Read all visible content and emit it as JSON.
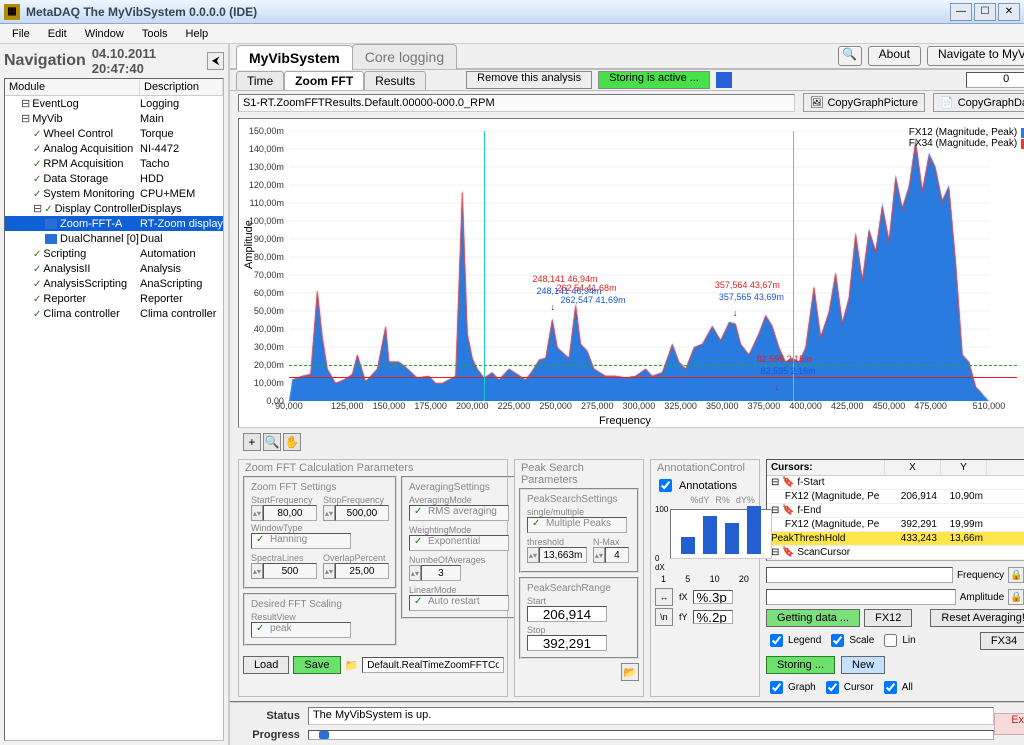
{
  "window": {
    "title": "MetaDAQ The MyVibSystem  0.0.0.0  (IDE)",
    "menus": [
      "File",
      "Edit",
      "Window",
      "Tools",
      "Help"
    ]
  },
  "nav": {
    "title": "Navigation",
    "datetime": "04.10.2011  20:47:40"
  },
  "tree": {
    "headers": [
      "Module",
      "Description"
    ],
    "rows": [
      {
        "ind": 1,
        "exp": "minus",
        "chk": false,
        "label": "EventLog",
        "desc": "Logging"
      },
      {
        "ind": 1,
        "exp": "minus",
        "chk": false,
        "label": "MyVib",
        "desc": "Main"
      },
      {
        "ind": 2,
        "chk": true,
        "label": "Wheel Control",
        "desc": "Torque"
      },
      {
        "ind": 2,
        "chk": true,
        "label": "Analog Acquisition",
        "desc": "NI-4472"
      },
      {
        "ind": 2,
        "chk": true,
        "label": "RPM Acquisition",
        "desc": "Tacho"
      },
      {
        "ind": 2,
        "chk": true,
        "label": "Data Storage",
        "desc": "HDD"
      },
      {
        "ind": 2,
        "chk": true,
        "label": "System Monitoring",
        "desc": "CPU+MEM"
      },
      {
        "ind": 2,
        "exp": "minus",
        "chk": true,
        "label": "Display Controller",
        "desc": "Displays"
      },
      {
        "ind": 3,
        "sel": true,
        "icon": "blue",
        "label": "Zoom-FFT-A",
        "desc": "RT-Zoom display"
      },
      {
        "ind": 3,
        "icon": "blue",
        "label": "DualChannel [0]",
        "desc": "Dual"
      },
      {
        "ind": 2,
        "chk": true,
        "label": "Scripting",
        "desc": "Automation"
      },
      {
        "ind": 2,
        "chk": true,
        "label": "AnalysisII",
        "desc": "Analysis"
      },
      {
        "ind": 2,
        "chk": true,
        "label": "AnalysisScripting",
        "desc": "AnaScripting"
      },
      {
        "ind": 2,
        "chk": true,
        "label": "Reporter",
        "desc": "Reporter"
      },
      {
        "ind": 2,
        "chk": true,
        "label": "Clima controller",
        "desc": "Clima controller"
      }
    ]
  },
  "main_tabs": {
    "items": [
      "MyVibSystem",
      "Core logging"
    ],
    "active": 0
  },
  "main_buttons": {
    "about": "About",
    "navigate": "Navigate to MyVib"
  },
  "sub_tabs": {
    "items": [
      "Time",
      "Zoom FFT",
      "Results"
    ],
    "active": 1,
    "remove": "Remove this analysis",
    "storing": "Storing is active ...",
    "counter": "0"
  },
  "chart_row": {
    "filename": "S1-RT.ZoomFFTResults.Default.00000-000.0_RPM",
    "copy_pic": "CopyGraphPicture",
    "copy_data": "CopyGraphData"
  },
  "chart_data": {
    "type": "line",
    "title": "",
    "xlabel": "Frequency",
    "ylabel": "Amplitude",
    "xlim": [
      90000,
      510000
    ],
    "ylim": [
      0,
      0.15
    ],
    "xticks": [
      90000,
      125000,
      150000,
      175000,
      200000,
      225000,
      250000,
      275000,
      300000,
      325000,
      350000,
      375000,
      400000,
      425000,
      450000,
      475000,
      510000
    ],
    "yticks_labels": [
      "0,00",
      "10,00m",
      "20,00m",
      "30,00m",
      "40,00m",
      "50,00m",
      "60,00m",
      "70,00m",
      "80,00m",
      "90,00m",
      "100,00m",
      "110,00m",
      "120,00m",
      "130,00m",
      "140,00m",
      "150,00m"
    ],
    "threshold_line_red": 0.0137,
    "threshold_line_green": 0.02,
    "vlines": [
      {
        "x": 392291,
        "color": "orange",
        "name": "f-End"
      },
      {
        "x": 206914,
        "color": "cyan",
        "name": "f-Start"
      }
    ],
    "series": [
      {
        "name": "FX12 (Magnitude, Peak)",
        "color": "#2a7be0"
      },
      {
        "name": "FX34 (Magnitude, Peak)",
        "color": "#e03a3a"
      }
    ],
    "annotations": [
      {
        "color": "red",
        "x": 248141,
        "y": 0.04694,
        "label": "248,141 46,94m"
      },
      {
        "color": "blue",
        "x": 248141,
        "y": 0.04694,
        "label": "248,141 46,94m"
      },
      {
        "color": "red",
        "x": 262547,
        "y": 0.04168,
        "label": "262,54 41,68m"
      },
      {
        "color": "blue",
        "x": 262547,
        "y": 0.04169,
        "label": "262,547 41,69m"
      },
      {
        "color": "red",
        "x": 357564,
        "y": 0.04367,
        "label": "357,564 43,67m"
      },
      {
        "color": "blue",
        "x": 357565,
        "y": 0.04369,
        "label": "357,565 43,69m"
      },
      {
        "color": "red",
        "x": 382595,
        "y": 0.00215,
        "label": "82,595 2,15m"
      },
      {
        "color": "blue",
        "x": 382595,
        "y": 0.00216,
        "label": "82,595 2,16m"
      }
    ],
    "profile": [
      [
        92,
        12
      ],
      [
        98,
        14
      ],
      [
        103,
        15
      ],
      [
        107,
        62
      ],
      [
        110,
        36
      ],
      [
        113,
        18
      ],
      [
        118,
        10
      ],
      [
        123,
        12
      ],
      [
        128,
        15
      ],
      [
        131,
        26
      ],
      [
        136,
        11
      ],
      [
        143,
        18
      ],
      [
        148,
        42
      ],
      [
        150,
        22
      ],
      [
        156,
        22
      ],
      [
        160,
        19
      ],
      [
        167,
        13
      ],
      [
        174,
        14
      ],
      [
        178,
        10
      ],
      [
        182,
        10
      ],
      [
        186,
        12
      ],
      [
        190,
        14
      ],
      [
        194,
        118
      ],
      [
        197,
        38
      ],
      [
        200,
        24
      ],
      [
        203,
        18
      ],
      [
        207,
        13
      ],
      [
        212,
        16
      ],
      [
        216,
        12
      ],
      [
        222,
        18
      ],
      [
        227,
        15
      ],
      [
        232,
        12
      ],
      [
        236,
        17
      ],
      [
        240,
        23
      ],
      [
        244,
        24
      ],
      [
        248,
        46
      ],
      [
        251,
        30
      ],
      [
        258,
        24
      ],
      [
        262,
        54
      ],
      [
        265,
        32
      ],
      [
        269,
        28
      ],
      [
        273,
        18
      ],
      [
        280,
        14
      ],
      [
        286,
        14
      ],
      [
        292,
        13
      ],
      [
        298,
        14
      ],
      [
        304,
        18
      ],
      [
        308,
        14
      ],
      [
        314,
        16
      ],
      [
        320,
        32
      ],
      [
        324,
        22
      ],
      [
        328,
        18
      ],
      [
        333,
        30
      ],
      [
        338,
        32
      ],
      [
        344,
        42
      ],
      [
        349,
        34
      ],
      [
        354,
        44
      ],
      [
        358,
        43
      ],
      [
        361,
        32
      ],
      [
        366,
        26
      ],
      [
        372,
        38
      ],
      [
        376,
        48
      ],
      [
        380,
        42
      ],
      [
        384,
        30
      ],
      [
        388,
        22
      ],
      [
        392,
        24
      ],
      [
        396,
        22
      ],
      [
        400,
        30
      ],
      [
        405,
        64
      ],
      [
        409,
        36
      ],
      [
        414,
        50
      ],
      [
        418,
        72
      ],
      [
        422,
        44
      ],
      [
        426,
        58
      ],
      [
        430,
        94
      ],
      [
        434,
        68
      ],
      [
        438,
        96
      ],
      [
        442,
        84
      ],
      [
        446,
        110
      ],
      [
        450,
        90
      ],
      [
        454,
        126
      ],
      [
        458,
        108
      ],
      [
        462,
        120
      ],
      [
        466,
        146
      ],
      [
        470,
        118
      ],
      [
        474,
        138
      ],
      [
        478,
        130
      ],
      [
        482,
        112
      ],
      [
        486,
        120
      ],
      [
        490,
        78
      ],
      [
        494,
        26
      ],
      [
        498,
        22
      ],
      [
        502,
        8
      ],
      [
        506,
        4
      ]
    ]
  },
  "zoom_fft_params": {
    "title": "Zoom FFT Calculation Parameters",
    "settings_title": "Zoom FFT Settings",
    "start_freq_label": "StartFrequency",
    "start_freq": "80,00",
    "stop_freq_label": "StopFrequency",
    "stop_freq": "500,00",
    "window_type_label": "WindowType",
    "window_type": "Hanning",
    "spectra_label": "SpectraLines",
    "spectra": "500",
    "overlap_label": "OverlapPercent",
    "overlap": "25,00",
    "scaling_title": "Desired FFT Scaling",
    "result_view_label": "ResultView",
    "result_view": "peak",
    "avg_title": "AveragingSettings",
    "avg_mode_label": "AveragingMode",
    "avg_mode": "RMS averaging",
    "weight_label": "WeightingMode",
    "weight_mode": "Exponential",
    "num_avg_label": "NumbeOfAverages",
    "num_avg": "3",
    "lin_label": "LinearMode",
    "lin_mode": "Auto restart"
  },
  "peak_search": {
    "title": "Peak Search Parameters",
    "settings_title": "PeakSearchSettings",
    "single_multiple_label": "single/multiple",
    "single_multiple": "Multiple Peaks",
    "threshold_label": "threshold",
    "threshold": "13,663m",
    "nmax_label": "N-Max",
    "nmax": "4",
    "range_title": "PeakSearchRange",
    "start_label": "Start",
    "start": "206,914",
    "stop_label": "Stop",
    "stop": "392,291"
  },
  "annotations_ctrl": {
    "title": "AnnotationControl",
    "checkbox": "Annotations",
    "headers": [
      "%dY",
      "R%",
      "dY%"
    ],
    "bar_values": [
      35,
      80,
      65,
      100
    ],
    "axis_ticks": [
      "1",
      "5",
      "10",
      "20"
    ],
    "fX": "%.3p",
    "fY": "%.2p"
  },
  "cursors": {
    "title": "Cursors:",
    "cols": [
      "X",
      "Y"
    ],
    "rows": [
      {
        "exp": "minus",
        "name": "f-Start",
        "x": "",
        "y": ""
      },
      {
        "child": true,
        "name": "FX12 (Magnitude, Pe",
        "x": "206,914",
        "y": "10,90m"
      },
      {
        "exp": "minus",
        "name": "f-End",
        "x": "",
        "y": ""
      },
      {
        "child": true,
        "name": "FX12 (Magnitude, Pe",
        "x": "392,291",
        "y": "19,99m"
      },
      {
        "hl": true,
        "name": "PeakThreshHold",
        "x": "433,243",
        "y": "13,66m"
      },
      {
        "exp": "minus",
        "name": "ScanCursor",
        "x": "",
        "y": ""
      }
    ],
    "freq_label": "Frequency",
    "amp_label": "Amplitude",
    "getting": "Getting data ...",
    "reset": "Reset Averaging!",
    "fx12": "FX12",
    "fx34": "FX34",
    "storing": "Storing ...",
    "new": "New"
  },
  "legend_checks": [
    "Legend",
    "Scale",
    "Lin",
    "Graph",
    "Cursor",
    "All"
  ],
  "file_row": {
    "load": "Load",
    "save": "Save",
    "filename": "Default.RealTimeZoomFFTConfig"
  },
  "status": {
    "status_label": "Status",
    "status_text": "The MyVibSystem is up.",
    "progress_label": "Progress",
    "exit": "Exit"
  }
}
